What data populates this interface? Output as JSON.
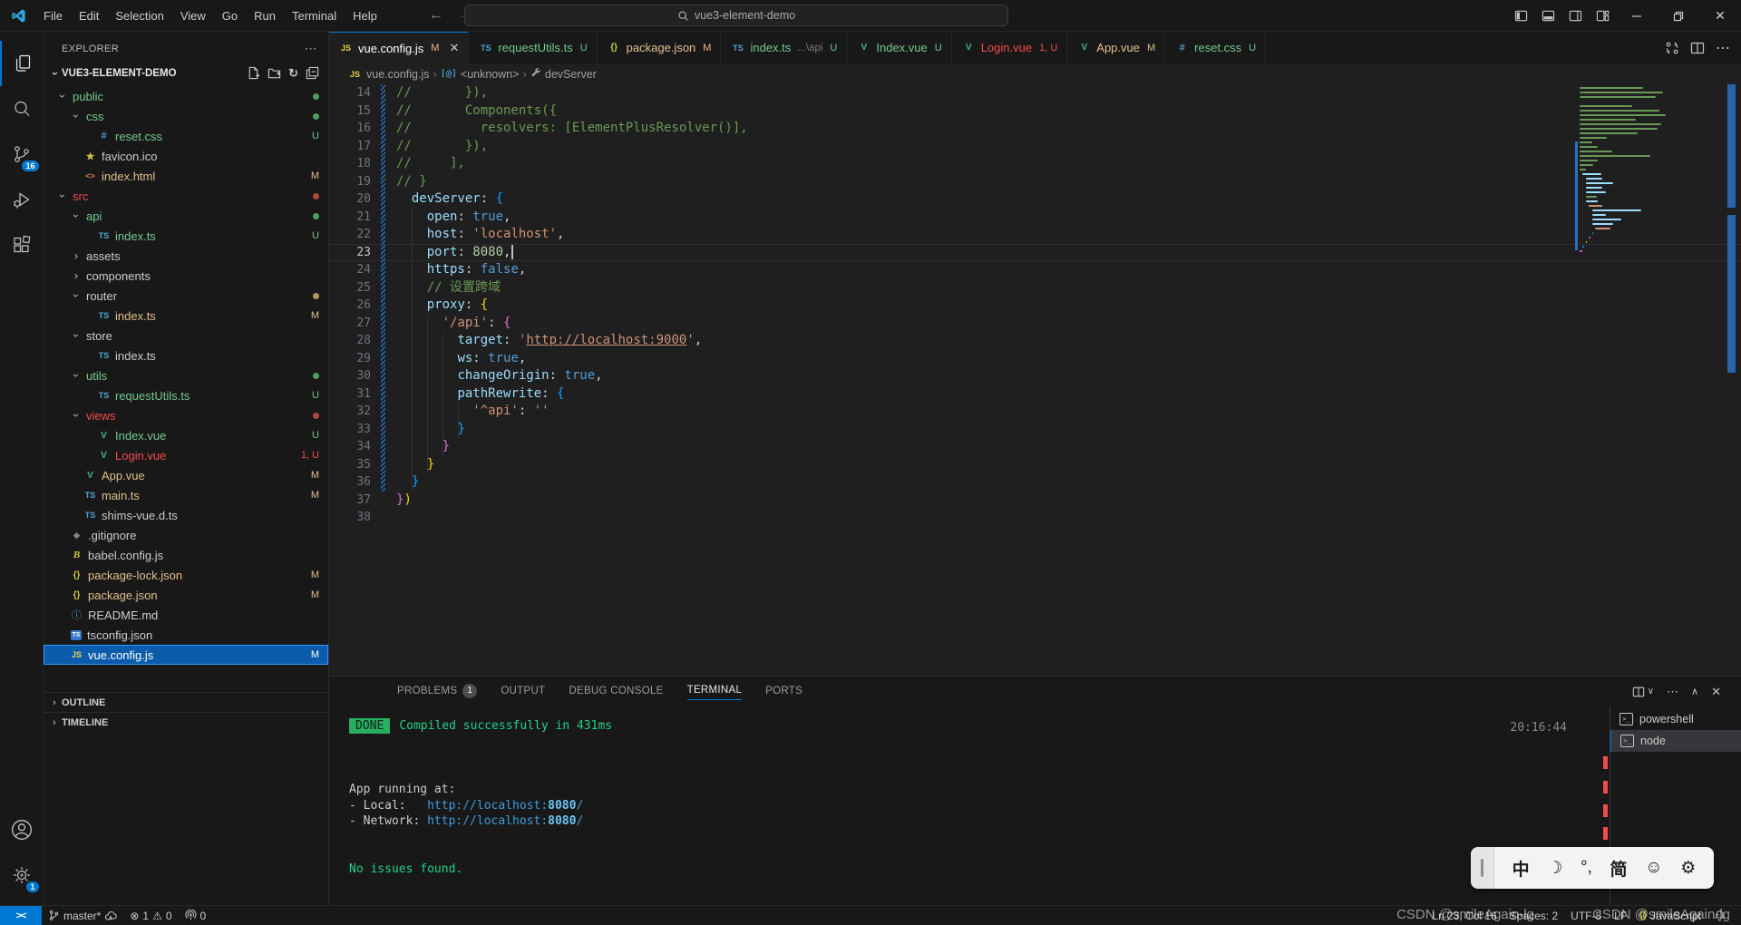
{
  "title_bar": {
    "menus": [
      "File",
      "Edit",
      "Selection",
      "View",
      "Go",
      "Run",
      "Terminal",
      "Help"
    ],
    "search_value": "vue3-element-demo"
  },
  "activity": {
    "scm_badge": "16",
    "settings_badge": "1"
  },
  "sidebar": {
    "title": "EXPLORER",
    "section": "VUE3-ELEMENT-DEMO",
    "tree": [
      {
        "label": "public",
        "kind": "folder",
        "expanded": true,
        "indent": 0,
        "color": "green",
        "badge": "dot",
        "badge_color": "green"
      },
      {
        "label": "css",
        "kind": "folder",
        "expanded": true,
        "indent": 1,
        "color": "green",
        "badge": "dot",
        "badge_color": "green"
      },
      {
        "label": "reset.css",
        "kind": "file",
        "icon": "css",
        "indent": 2,
        "color": "green",
        "badge": "U",
        "badge_color": "green"
      },
      {
        "label": "favicon.ico",
        "kind": "file",
        "icon": "star",
        "indent": 1,
        "color": "default"
      },
      {
        "label": "index.html",
        "kind": "file",
        "icon": "html",
        "indent": 1,
        "color": "mod",
        "badge": "M",
        "badge_color": "mod"
      },
      {
        "label": "src",
        "kind": "folder",
        "expanded": true,
        "indent": 0,
        "color": "err",
        "badge": "dot",
        "badge_color": "err"
      },
      {
        "label": "api",
        "kind": "folder",
        "expanded": true,
        "indent": 1,
        "color": "green",
        "badge": "dot",
        "badge_color": "green"
      },
      {
        "label": "index.ts",
        "kind": "file",
        "icon": "ts",
        "indent": 2,
        "color": "green",
        "badge": "U",
        "badge_color": "green"
      },
      {
        "label": "assets",
        "kind": "folder",
        "expanded": false,
        "indent": 1,
        "color": "default"
      },
      {
        "label": "components",
        "kind": "folder",
        "expanded": false,
        "indent": 1,
        "color": "default"
      },
      {
        "label": "router",
        "kind": "folder",
        "expanded": true,
        "indent": 1,
        "color": "default",
        "badge": "dot",
        "badge_color": "mod"
      },
      {
        "label": "index.ts",
        "kind": "file",
        "icon": "ts",
        "indent": 2,
        "color": "mod",
        "badge": "M",
        "badge_color": "mod"
      },
      {
        "label": "store",
        "kind": "folder",
        "expanded": true,
        "indent": 1,
        "color": "default"
      },
      {
        "label": "index.ts",
        "kind": "file",
        "icon": "ts",
        "indent": 2,
        "color": "default"
      },
      {
        "label": "utils",
        "kind": "folder",
        "expanded": true,
        "indent": 1,
        "color": "green",
        "badge": "dot",
        "badge_color": "green"
      },
      {
        "label": "requestUtils.ts",
        "kind": "file",
        "icon": "ts",
        "indent": 2,
        "color": "green",
        "badge": "U",
        "badge_color": "green"
      },
      {
        "label": "views",
        "kind": "folder",
        "expanded": true,
        "indent": 1,
        "color": "err",
        "badge": "dot",
        "badge_color": "err"
      },
      {
        "label": "Index.vue",
        "kind": "file",
        "icon": "vue",
        "indent": 2,
        "color": "green",
        "badge": "U",
        "badge_color": "green"
      },
      {
        "label": "Login.vue",
        "kind": "file",
        "icon": "vue",
        "indent": 2,
        "color": "err",
        "badge": "1, U",
        "badge_color": "err"
      },
      {
        "label": "App.vue",
        "kind": "file",
        "icon": "vue",
        "indent": 1,
        "color": "mod",
        "badge": "M",
        "badge_color": "mod"
      },
      {
        "label": "main.ts",
        "kind": "file",
        "icon": "ts",
        "indent": 1,
        "color": "mod",
        "badge": "M",
        "badge_color": "mod"
      },
      {
        "label": "shims-vue.d.ts",
        "kind": "file",
        "icon": "ts",
        "indent": 1,
        "color": "default"
      },
      {
        "label": ".gitignore",
        "kind": "file",
        "icon": "git",
        "indent": 0,
        "color": "default"
      },
      {
        "label": "babel.config.js",
        "kind": "file",
        "icon": "babel",
        "indent": 0,
        "color": "default"
      },
      {
        "label": "package-lock.json",
        "kind": "file",
        "icon": "json",
        "indent": 0,
        "color": "mod",
        "badge": "M",
        "badge_color": "mod"
      },
      {
        "label": "package.json",
        "kind": "file",
        "icon": "json",
        "indent": 0,
        "color": "mod",
        "badge": "M",
        "badge_color": "mod"
      },
      {
        "label": "README.md",
        "kind": "file",
        "icon": "info",
        "indent": 0,
        "color": "default"
      },
      {
        "label": "tsconfig.json",
        "kind": "file",
        "icon": "tsconfig",
        "indent": 0,
        "color": "default"
      },
      {
        "label": "vue.config.js",
        "kind": "file",
        "icon": "js",
        "indent": 0,
        "color": "light",
        "badge": "M",
        "badge_color": "light",
        "selected": true
      }
    ],
    "sections": [
      "OUTLINE",
      "TIMELINE"
    ]
  },
  "tabs": [
    {
      "icon": "js",
      "label": "vue.config.js",
      "color": "default",
      "badge": "M",
      "badge_color": "mod",
      "active": true
    },
    {
      "icon": "ts",
      "label": "requestUtils.ts",
      "color": "green",
      "badge": "U",
      "badge_color": "green"
    },
    {
      "icon": "json",
      "label": "package.json",
      "color": "mod",
      "badge": "M",
      "badge_color": "mod"
    },
    {
      "icon": "ts",
      "label": "index.ts",
      "desc": "...\\api",
      "color": "green",
      "badge": "U",
      "badge_color": "green"
    },
    {
      "icon": "vue",
      "label": "Index.vue",
      "color": "green",
      "badge": "U",
      "badge_color": "green"
    },
    {
      "icon": "vue",
      "label": "Login.vue",
      "color": "err",
      "badge": "1, U",
      "badge_color": "err"
    },
    {
      "icon": "vue",
      "label": "App.vue",
      "color": "mod",
      "badge": "M",
      "badge_color": "mod"
    },
    {
      "icon": "css",
      "label": "reset.css",
      "color": "green",
      "badge": "U",
      "badge_color": "green"
    }
  ],
  "breadcrumbs": [
    {
      "icon": "js",
      "label": "vue.config.js"
    },
    {
      "icon": "symbol",
      "label": "<unknown>"
    },
    {
      "icon": "wrench",
      "label": "devServer"
    }
  ],
  "editor": {
    "active_line": 23,
    "lines": [
      {
        "n": 14,
        "t": [
          [
            "//       }),",
            "cm"
          ]
        ]
      },
      {
        "n": 15,
        "t": [
          [
            "//       Components({",
            "cm"
          ]
        ]
      },
      {
        "n": 16,
        "t": [
          [
            "//         resolvers: [ElementPlusResolver()],",
            "cm"
          ]
        ]
      },
      {
        "n": 17,
        "t": [
          [
            "//       }),",
            "cm"
          ]
        ]
      },
      {
        "n": 18,
        "t": [
          [
            "//     ],",
            "cm"
          ]
        ]
      },
      {
        "n": 19,
        "t": [
          [
            "// }",
            "cm"
          ]
        ]
      },
      {
        "n": 20,
        "t": [
          [
            "  ",
            ""
          ],
          [
            "devServer",
            "pr"
          ],
          [
            ": ",
            "pu"
          ],
          [
            "{",
            "b3"
          ]
        ]
      },
      {
        "n": 21,
        "t": [
          [
            "    ",
            ""
          ],
          [
            "open",
            "pr"
          ],
          [
            ": ",
            "pu"
          ],
          [
            "true",
            "kw"
          ],
          [
            ",",
            "pu"
          ]
        ]
      },
      {
        "n": 22,
        "t": [
          [
            "    ",
            ""
          ],
          [
            "host",
            "pr"
          ],
          [
            ": ",
            "pu"
          ],
          [
            "'localhost'",
            "st"
          ],
          [
            ",",
            "pu"
          ]
        ]
      },
      {
        "n": 23,
        "t": [
          [
            "    ",
            ""
          ],
          [
            "port",
            "pr"
          ],
          [
            ": ",
            "pu"
          ],
          [
            "8080",
            "nu"
          ],
          [
            ",",
            "pu"
          ]
        ],
        "caret": true
      },
      {
        "n": 24,
        "t": [
          [
            "    ",
            ""
          ],
          [
            "https",
            "pr"
          ],
          [
            ": ",
            "pu"
          ],
          [
            "false",
            "kw"
          ],
          [
            ",",
            "pu"
          ]
        ]
      },
      {
        "n": 25,
        "t": [
          [
            "    ",
            ""
          ],
          [
            "// 设置跨域",
            "cm"
          ]
        ]
      },
      {
        "n": 26,
        "t": [
          [
            "    ",
            ""
          ],
          [
            "proxy",
            "pr"
          ],
          [
            ": ",
            "pu"
          ],
          [
            "{",
            "b1"
          ]
        ]
      },
      {
        "n": 27,
        "t": [
          [
            "      ",
            ""
          ],
          [
            "'/api'",
            "st"
          ],
          [
            ": ",
            "pu"
          ],
          [
            "{",
            "b2"
          ]
        ]
      },
      {
        "n": 28,
        "t": [
          [
            "        ",
            ""
          ],
          [
            "target",
            "pr"
          ],
          [
            ": ",
            "pu"
          ],
          [
            "'",
            "st"
          ],
          [
            "http://localhost:9000",
            "lk"
          ],
          [
            "'",
            "st"
          ],
          [
            ",",
            "pu"
          ]
        ]
      },
      {
        "n": 29,
        "t": [
          [
            "        ",
            ""
          ],
          [
            "ws",
            "pr"
          ],
          [
            ": ",
            "pu"
          ],
          [
            "true",
            "kw"
          ],
          [
            ",",
            "pu"
          ]
        ]
      },
      {
        "n": 30,
        "t": [
          [
            "        ",
            ""
          ],
          [
            "changeOrigin",
            "pr"
          ],
          [
            ": ",
            "pu"
          ],
          [
            "true",
            "kw"
          ],
          [
            ",",
            "pu"
          ]
        ]
      },
      {
        "n": 31,
        "t": [
          [
            "        ",
            ""
          ],
          [
            "pathRewrite",
            "pr"
          ],
          [
            ": ",
            "pu"
          ],
          [
            "{",
            "b3"
          ]
        ]
      },
      {
        "n": 32,
        "t": [
          [
            "          ",
            ""
          ],
          [
            "'^api'",
            "st"
          ],
          [
            ": ",
            "pu"
          ],
          [
            "''",
            "st"
          ]
        ]
      },
      {
        "n": 33,
        "t": [
          [
            "        ",
            ""
          ],
          [
            "}",
            "b3"
          ]
        ]
      },
      {
        "n": 34,
        "t": [
          [
            "      ",
            ""
          ],
          [
            "}",
            "b2"
          ]
        ]
      },
      {
        "n": 35,
        "t": [
          [
            "    ",
            ""
          ],
          [
            "}",
            "b1"
          ]
        ]
      },
      {
        "n": 36,
        "t": [
          [
            "  ",
            ""
          ],
          [
            "}",
            "b3"
          ]
        ]
      },
      {
        "n": 37,
        "t": [
          [
            "}",
            "b2"
          ],
          [
            ")",
            "b1"
          ]
        ]
      },
      {
        "n": 38,
        "t": []
      }
    ]
  },
  "panel": {
    "tabs": [
      {
        "label": "PROBLEMS",
        "badge": "1"
      },
      {
        "label": "OUTPUT"
      },
      {
        "label": "DEBUG CONSOLE"
      },
      {
        "label": "TERMINAL",
        "active": true
      },
      {
        "label": "PORTS"
      }
    ],
    "terminal": {
      "badge": "DONE",
      "message": "Compiled successfully in 431ms",
      "time": "20:16:44",
      "running": "App running at:",
      "local_prefix": "- Local:   ",
      "network_prefix": "- Network: ",
      "url": "http://localhost:",
      "port": "8080",
      "slash": "/",
      "no_issues": "No issues found.",
      "sessions": [
        {
          "label": "powershell"
        },
        {
          "label": "node",
          "active": true
        }
      ]
    }
  },
  "status": {
    "branch": "master*",
    "errors": "1",
    "warnings": "0",
    "feedback": "0",
    "ln_col": "Ln 23, Col 16",
    "spaces": "Spaces: 2",
    "encoding": "UTF-8",
    "eol": "LF",
    "lang": "JavaScript"
  },
  "ime": {
    "items": [
      "中",
      "☽",
      "°,",
      "简",
      "☺",
      "⚙"
    ]
  },
  "watermark": "CSDN @smileAgain-lg"
}
